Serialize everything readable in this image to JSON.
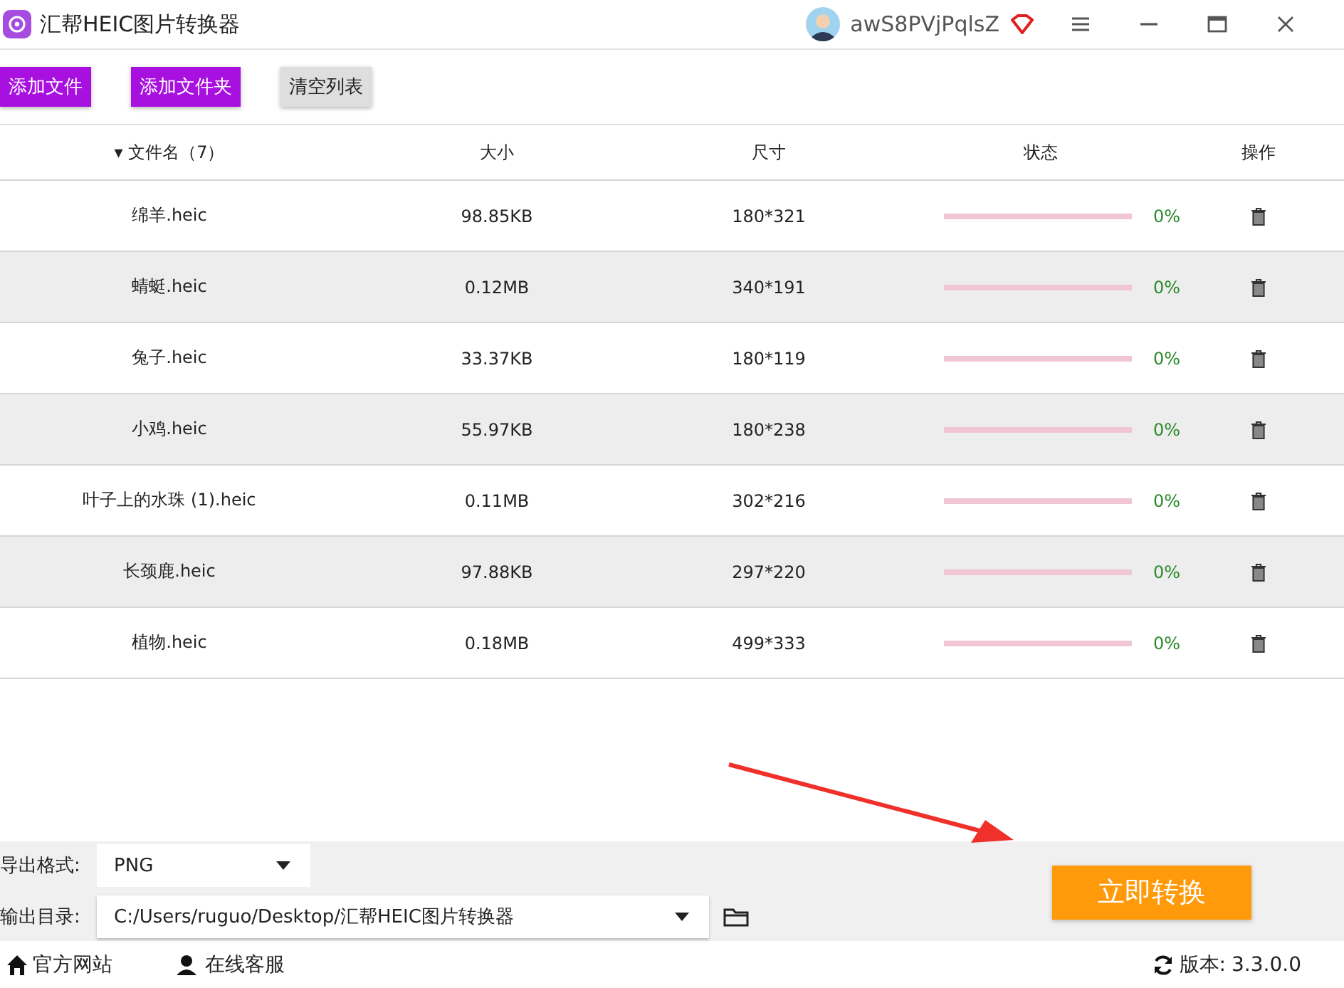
{
  "window": {
    "title": "汇帮HEIC图片转换器",
    "username": "awS8PVjPqlsZ"
  },
  "toolbar": [
    "添加文件",
    "添加文件夹",
    "清空列表"
  ],
  "table": {
    "columns": [
      {
        "label": "▾ 文件名（7）"
      },
      {
        "label": "大小"
      },
      {
        "label": "尺寸"
      },
      {
        "label": "状态"
      },
      {
        "label": "操作"
      }
    ],
    "rows": [
      {
        "name": "绵羊.heic",
        "size": "98.85KB",
        "dimensions": "180*321",
        "level": 0,
        "percent": "0%"
      },
      {
        "name": "蜻蜓.heic",
        "size": "0.12MB",
        "dimensions": "340*191",
        "level": 0,
        "percent": "0%"
      },
      {
        "name": "兔子.heic",
        "size": "33.37KB",
        "dimensions": "180*119",
        "level": 0,
        "percent": "0%"
      },
      {
        "name": "小鸡.heic",
        "size": "55.97KB",
        "dimensions": "180*238",
        "level": 0,
        "percent": "0%"
      },
      {
        "name": "叶子上的水珠 (1).heic",
        "size": "0.11MB",
        "dimensions": "302*216",
        "level": 0,
        "percent": "0%"
      },
      {
        "name": "长颈鹿.heic",
        "size": "97.88KB",
        "dimensions": "297*220",
        "level": 0,
        "percent": "0%"
      },
      {
        "name": "植物.heic",
        "size": "0.18MB",
        "dimensions": "499*333",
        "level": 0,
        "percent": "0%"
      }
    ]
  },
  "settings": {
    "format_label": "导出格式:",
    "format": "PNG",
    "output_label": "输出目录:",
    "output_dir": "C:/Users/ruguo/Desktop/汇帮HEIC图片转换器"
  },
  "convert_button": "立即转换",
  "footer": {
    "website": "官方网站",
    "support": "在线客服",
    "version_label": "版本:",
    "version": "3.3.0.0"
  }
}
